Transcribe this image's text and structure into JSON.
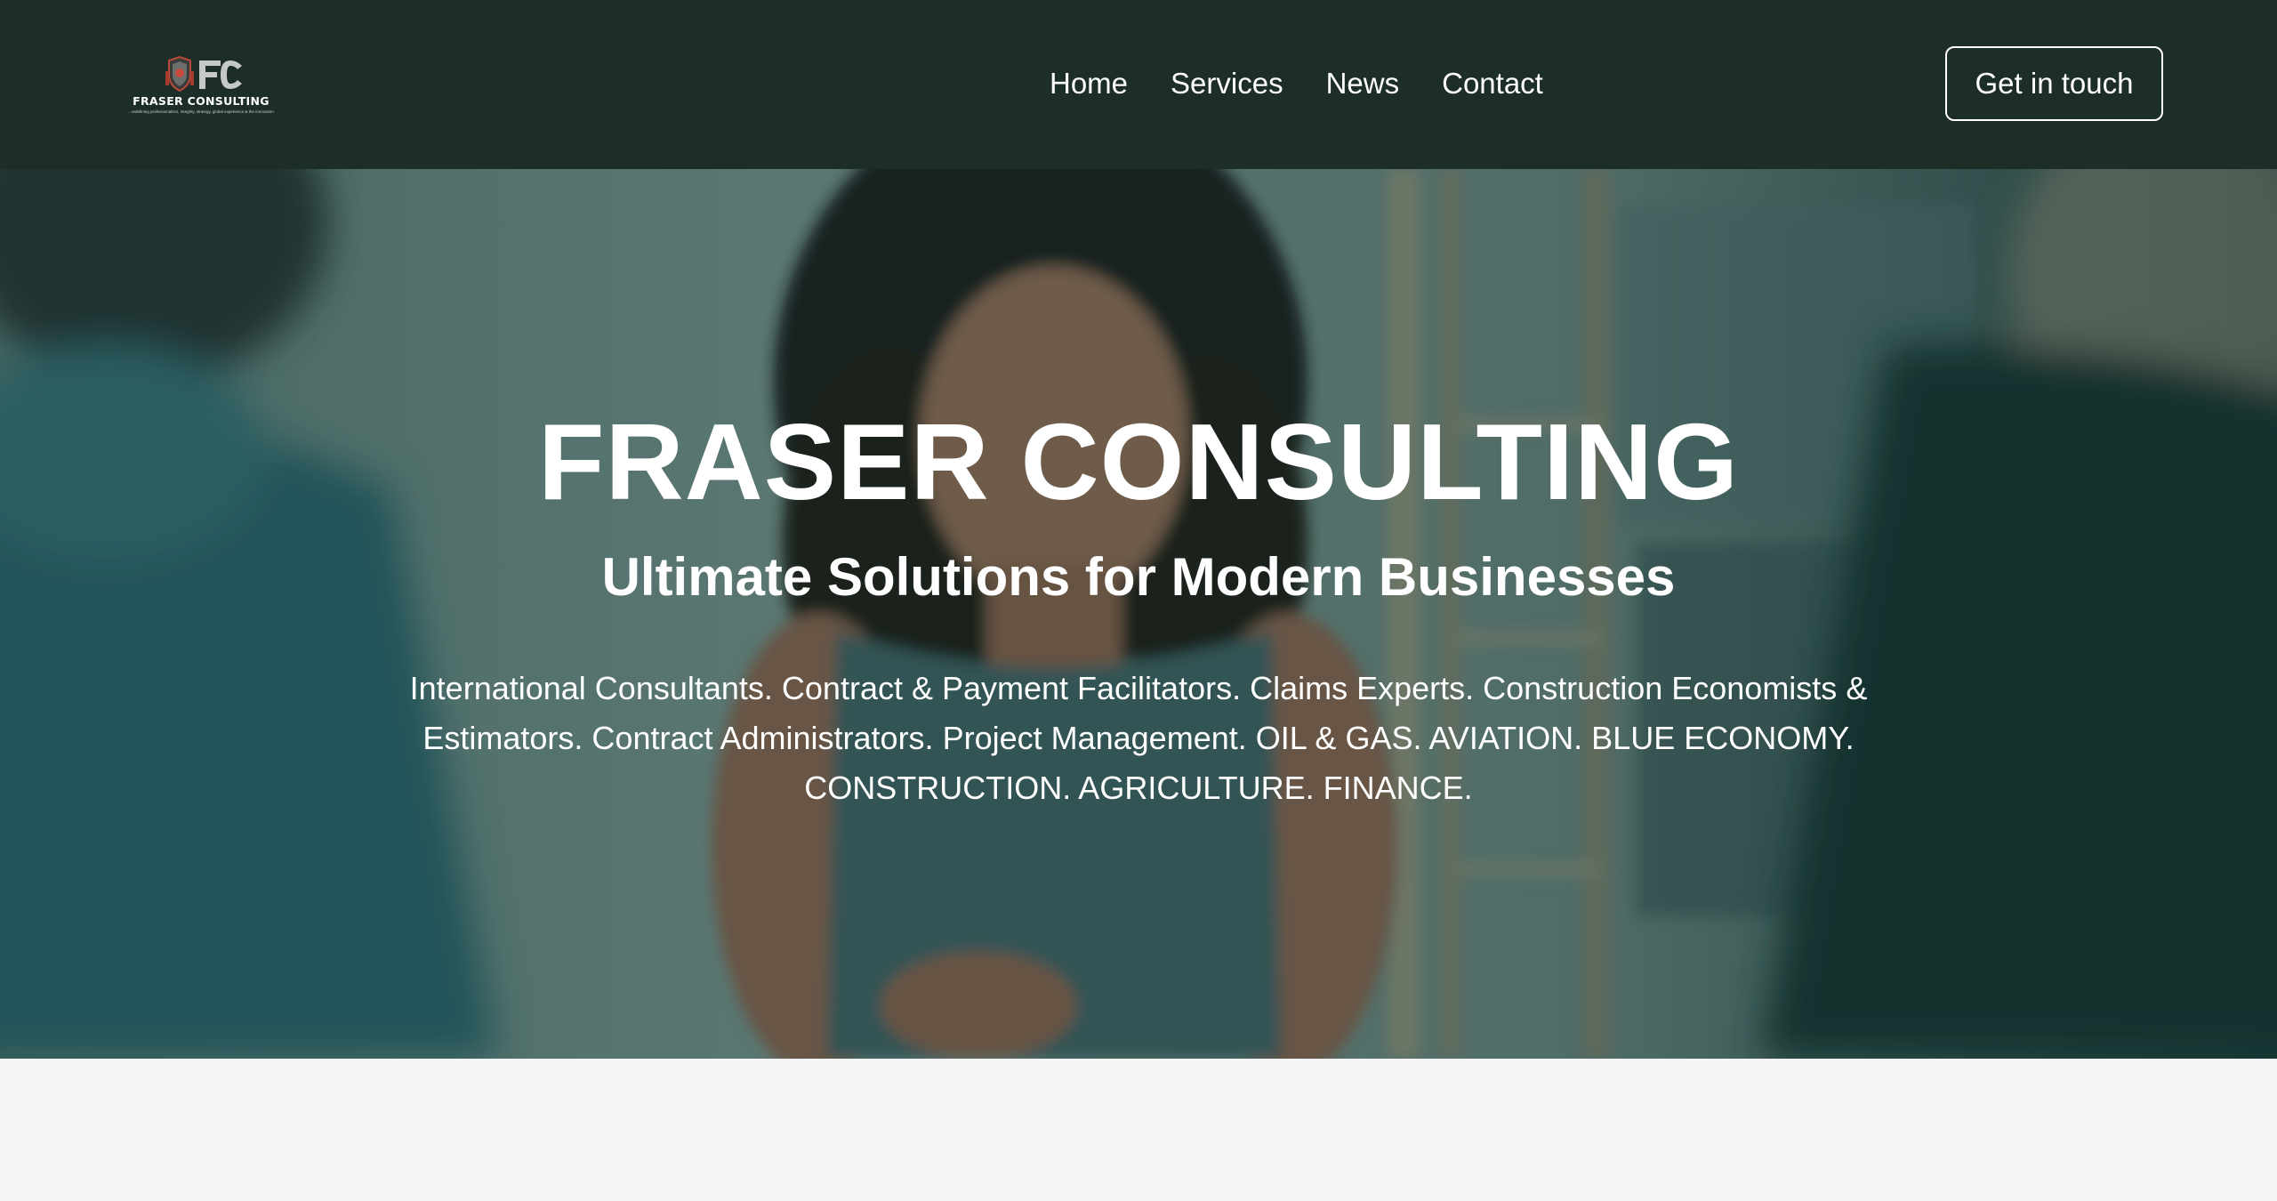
{
  "brand": {
    "name": "FRASER CONSULTING",
    "monogram": "FC",
    "tagline": "...redefining professionalism, integrity, strategy, global experience & the innovation",
    "icon": "crest-logo-icon"
  },
  "nav": {
    "items": [
      {
        "label": "Home"
      },
      {
        "label": "Services"
      },
      {
        "label": "News"
      },
      {
        "label": "Contact"
      }
    ],
    "cta_label": "Get in touch"
  },
  "hero": {
    "title": "FRASER CONSULTING",
    "subtitle": "Ultimate Solutions for Modern Businesses",
    "description": "International Consultants. Contract & Payment Facilitators. Claims Experts. Construction Economists & Estimators. Contract Administrators. Project Management. OIL & GAS. AVIATION. BLUE ECONOMY. CONSTRUCTION. AGRICULTURE. FINANCE."
  },
  "colors": {
    "header_bg": "#1d2d27",
    "hero_tint": "#123432",
    "page_bg": "#f3f4f6",
    "text_light": "#ffffff"
  }
}
